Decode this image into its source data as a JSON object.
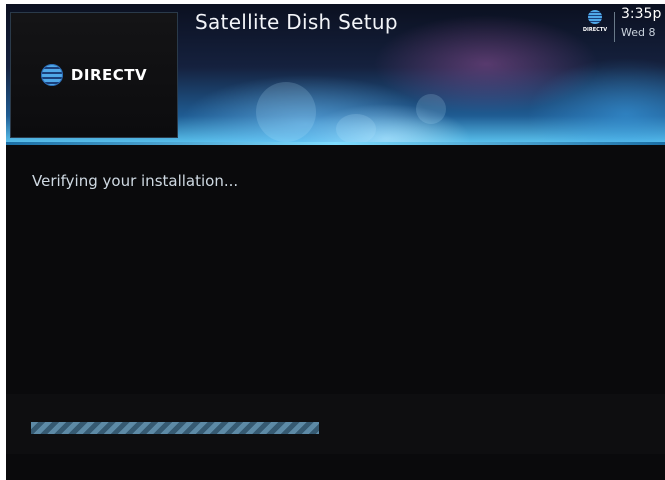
{
  "header": {
    "title": "Satellite Dish Setup",
    "brand": "DIRECTV",
    "corner_brand": "DIRECTV",
    "time": "3:35p",
    "date": "Wed 8"
  },
  "main": {
    "status_text": "Verifying your installation..."
  },
  "progress": {
    "fraction": 0.48
  },
  "colors": {
    "accent": "#7fdcff",
    "progress": "#5d8aa6"
  }
}
